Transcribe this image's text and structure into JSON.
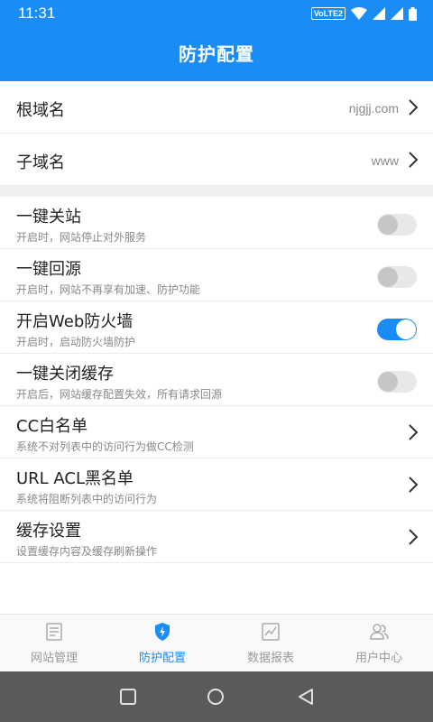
{
  "status_bar": {
    "time": "11:31",
    "network_badge": "VoLTE2"
  },
  "app_bar": {
    "title": "防护配置"
  },
  "domain_rows": [
    {
      "label": "根域名",
      "value": "njgjj.com"
    },
    {
      "label": "子域名",
      "value": "www"
    }
  ],
  "settings": [
    {
      "label": "一键关站",
      "desc": "开启时，网站停止对外服务",
      "control": "toggle",
      "on": false
    },
    {
      "label": "一键回源",
      "desc": "开启时，网站不再享有加速、防护功能",
      "control": "toggle",
      "on": false
    },
    {
      "label": "开启Web防火墙",
      "desc": "开启时，启动防火墙防护",
      "control": "toggle",
      "on": true
    },
    {
      "label": "一键关闭缓存",
      "desc": "开启后，网站缓存配置失效，所有请求回源",
      "control": "toggle",
      "on": false
    },
    {
      "label": "CC白名单",
      "desc": "系统不对列表中的访问行为做CC检测",
      "control": "chevron"
    },
    {
      "label": "URL ACL黑名单",
      "desc": "系统将阻断列表中的访问行为",
      "control": "chevron"
    },
    {
      "label": "缓存设置",
      "desc": "设置缓存内容及缓存刷新操作",
      "control": "chevron"
    }
  ],
  "bottom_nav": [
    {
      "label": "网站管理",
      "icon": "site-list-icon",
      "active": false
    },
    {
      "label": "防护配置",
      "icon": "shield-bolt-icon",
      "active": true
    },
    {
      "label": "数据报表",
      "icon": "chart-icon",
      "active": false
    },
    {
      "label": "用户中心",
      "icon": "users-icon",
      "active": false
    }
  ],
  "colors": {
    "primary": "#1a8cf5",
    "inactive": "#999999",
    "system_nav": "#5a5a5a"
  }
}
